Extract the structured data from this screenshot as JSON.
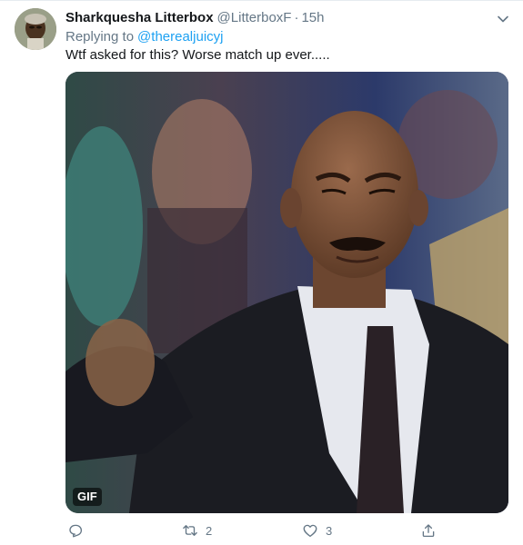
{
  "tweet": {
    "author_name": "Sharkquesha Litterbox",
    "author_handle": "@LitterboxF",
    "separator": "·",
    "time": "15h",
    "replying_label": "Replying to",
    "replying_to": "@therealjuicyj",
    "text": "Wtf asked for this? Worse match up ever.....",
    "media": {
      "badge": "GIF"
    }
  },
  "actions": {
    "reply_icon": "reply-icon",
    "retweet_icon": "retweet-icon",
    "retweet_count": "2",
    "like_icon": "heart-icon",
    "like_count": "3",
    "share_icon": "share-icon"
  },
  "colors": {
    "link": "#1da1f2",
    "secondary_text": "#657786",
    "primary_text": "#14171a"
  }
}
